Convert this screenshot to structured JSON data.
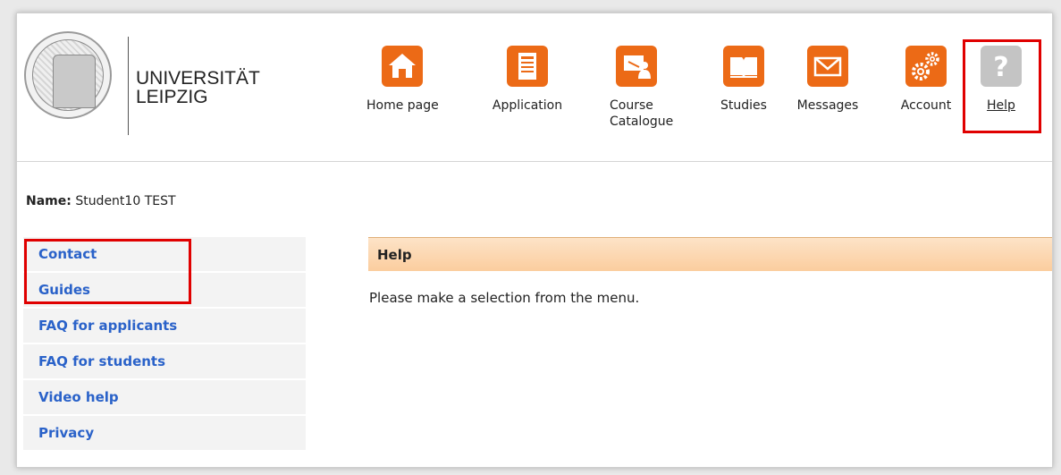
{
  "university": {
    "line1": "UNIVERSITÄT",
    "line2": "LEIPZIG"
  },
  "nav": [
    {
      "label": "Home page",
      "icon": "home-icon"
    },
    {
      "label": "Application",
      "icon": "document-icon"
    },
    {
      "label": "Course\nCatalogue",
      "icon": "presentation-icon"
    },
    {
      "label": "Studies",
      "icon": "book-icon"
    },
    {
      "label": "Messages",
      "icon": "envelope-icon"
    },
    {
      "label": "Account",
      "icon": "gears-icon"
    },
    {
      "label": "Help",
      "icon": "question-icon"
    }
  ],
  "user": {
    "name_label": "Name:",
    "name_value": "Student10 TEST"
  },
  "menu": [
    {
      "label": "Contact"
    },
    {
      "label": "Guides"
    },
    {
      "label": "FAQ for applicants"
    },
    {
      "label": "FAQ for students"
    },
    {
      "label": "Video help"
    },
    {
      "label": "Privacy"
    }
  ],
  "content": {
    "title": "Help",
    "message": "Please make a selection from the menu."
  },
  "colors": {
    "accent_orange": "#ec6a16",
    "link_blue": "#2a62c9",
    "highlight_red": "#e00000",
    "help_grey": "#c4c4c4"
  }
}
